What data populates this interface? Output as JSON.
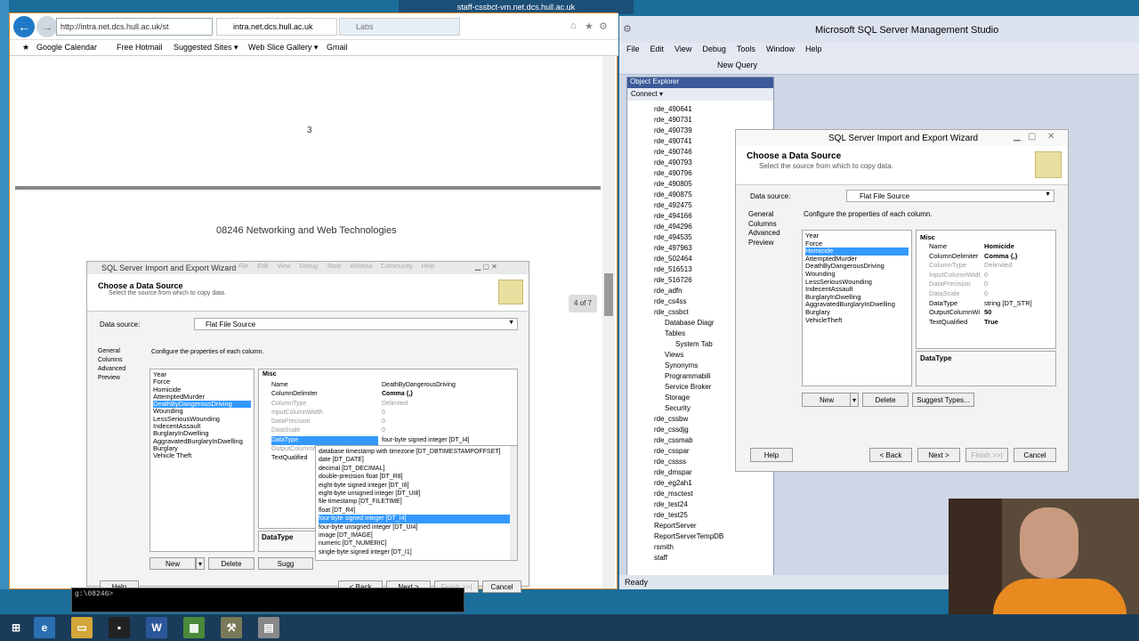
{
  "remote": {
    "title": "staff-cssbct-vm.net.dcs.hull.ac.uk"
  },
  "ie": {
    "address": "http://intra.net.dcs.hull.ac.uk/st",
    "tab_active": "intra.net.dcs.hull.ac.uk",
    "tab_other": "Labs",
    "favorites": [
      "Google Calendar",
      "Free Hotmail",
      "Suggested Sites ▾",
      "Web Slice Gallery ▾",
      "Gmail"
    ],
    "page_number": "3",
    "page_heading": "08246 Networking and Web Technologies",
    "page_indicator": "4 of 7"
  },
  "wiz1": {
    "title": "SQL Server Import and Export Wizard",
    "header": "Choose a Data Source",
    "subheader": "Select the source from which to copy data.",
    "data_source_label": "Data source:",
    "data_source_value": "Flat File Source",
    "instructions": "Configure the properties of each column.",
    "nav": [
      "General",
      "Columns",
      "Advanced",
      "Preview"
    ],
    "columns": [
      "Year",
      "Force",
      "Homicide",
      "AttemptedMurder",
      "DeathByDangerousDriving",
      "Wounding",
      "LessSeriousWounding",
      "IndecentAssault",
      "BurglaryInDwelling",
      "AggravatedBurglaryInDwelling",
      "Burglary",
      "Vehicle Theft"
    ],
    "selected_column": "DeathByDangerousDriving",
    "misc": "Misc",
    "props": [
      {
        "name": "Name",
        "value": "DeathByDangerousDriving"
      },
      {
        "name": "ColumnDelimiter",
        "value": "Comma {,}"
      },
      {
        "name": "ColumnType",
        "value": "Delimited"
      },
      {
        "name": "InputColumnWidth",
        "value": "0"
      },
      {
        "name": "DataPrecision",
        "value": "0"
      },
      {
        "name": "DataScale",
        "value": "0"
      },
      {
        "name": "DataType",
        "value": "four-byte signed integer [DT_I4]"
      },
      {
        "name": "OutputColumnW",
        "value": ""
      },
      {
        "name": "TextQualified",
        "value": ""
      }
    ],
    "dropdown": [
      "database timestamp with timezone [DT_DBTIMESTAMPOFFSET]",
      "date [DT_DATE]",
      "decimal [DT_DECIMAL]",
      "double-precision float [DT_R8]",
      "eight-byte signed integer [DT_I8]",
      "eight-byte unsigned integer [DT_UI8]",
      "file timestamp [DT_FILETIME]",
      "float [DT_R4]",
      "four-byte signed integer [DT_I4]",
      "four-byte unsigned integer [DT_UI4]",
      "image [DT_IMAGE]",
      "numeric [DT_NUMERIC]",
      "single-byte signed integer [DT_I1]"
    ],
    "dropdown_selected": "four-byte signed integer [DT_I4]",
    "desc_title": "DataType",
    "new_btn": "New",
    "delete_btn": "Delete",
    "suggest_btn": "Sugg",
    "help": "Help",
    "back": "< Back",
    "next": "Next >",
    "finish": "Finish >>|",
    "cancel": "Cancel",
    "menubar_ghost": [
      "File",
      "Edit",
      "View",
      "Debug",
      "Tools",
      "Window",
      "Community",
      "Help"
    ]
  },
  "ssms": {
    "title": "Microsoft SQL Server Management Studio",
    "menu": [
      "File",
      "Edit",
      "View",
      "Debug",
      "Tools",
      "Window",
      "Help"
    ],
    "new_query": "New Query",
    "oe_title": "Object Explorer",
    "connect": "Connect ▾",
    "tree": [
      "rde_490641",
      "rde_490731",
      "rde_490739",
      "rde_490741",
      "rde_490746",
      "rde_490793",
      "rde_490796",
      "rde_490805",
      "rde_490875",
      "rde_492475",
      "rde_494166",
      "rde_494296",
      "rde_494535",
      "rde_497963",
      "rde_502464",
      "rde_516513",
      "rde_516726",
      "rde_adfn",
      "rde_cs4ss",
      "rde_cssbct",
      "Database Diagr",
      "Tables",
      "System Tab",
      "Views",
      "Synonyms",
      "Programmabili",
      "Service Broker",
      "Storage",
      "Security",
      "rde_cssbw",
      "rde_cssdjg",
      "rde_cssmab",
      "rde_csspar",
      "rde_cssss",
      "rde_dmspar",
      "rde_eg2ah1",
      "rde_msctest",
      "rde_test24",
      "rde_test25",
      "ReportServer",
      "ReportServerTempDB",
      "rsmith",
      "staff"
    ],
    "status": "Ready"
  },
  "wiz2": {
    "title": "SQL Server Import and Export Wizard",
    "header": "Choose a Data Source",
    "subheader": "Select the source from which to copy data.",
    "data_source_label": "Data source:",
    "data_source_value": "Flat File Source",
    "instructions": "Configure the properties of each column.",
    "nav": [
      "General",
      "Columns",
      "Advanced",
      "Preview"
    ],
    "columns": [
      "Year",
      "Force",
      "Homicide",
      "AttemptedMurder",
      "DeathByDangerousDriving",
      "Wounding",
      "LessSeriousWounding",
      "IndecentAssault",
      "BurglaryInDwelling",
      "AggravatedBurglaryInDwelling",
      "Burglary",
      "VehicleTheft"
    ],
    "selected_column": "Homicide",
    "misc": "Misc",
    "props": [
      {
        "name": "Name",
        "value": "Homicide"
      },
      {
        "name": "ColumnDelimiter",
        "value": "Comma {,}"
      },
      {
        "name": "ColumnType",
        "value": "Delimited"
      },
      {
        "name": "InputColumnWidt",
        "value": "0"
      },
      {
        "name": "DataPrecision",
        "value": "0"
      },
      {
        "name": "DataScale",
        "value": "0"
      },
      {
        "name": "DataType",
        "value": "string [DT_STR]"
      },
      {
        "name": "OutputColumnWi",
        "value": "50"
      },
      {
        "name": "TextQualified",
        "value": "True"
      }
    ],
    "desc_title": "DataType",
    "new_btn": "New",
    "delete_btn": "Delete",
    "suggest_btn": "Suggest Types...",
    "help": "Help",
    "back": "< Back",
    "next": "Next >",
    "finish": "Finish >>|",
    "cancel": "Cancel"
  },
  "cmd": {
    "text": "g:\\08246>"
  },
  "taskbar": {
    "word": "W"
  }
}
